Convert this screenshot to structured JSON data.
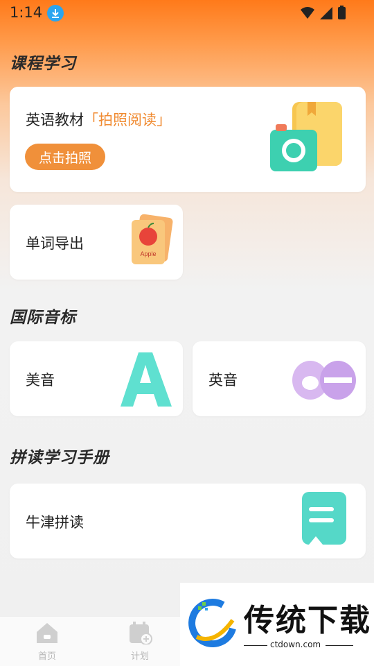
{
  "status_bar": {
    "time": "1:14"
  },
  "sections": {
    "course": {
      "title": "课程学习"
    },
    "phonetics": {
      "title": "国际音标"
    },
    "phonics": {
      "title": "拼读学习手册"
    }
  },
  "cards": {
    "textbook": {
      "label": "英语教材",
      "highlight": "「拍照阅读」",
      "button": "点击拍照"
    },
    "word_export": {
      "label": "单词导出",
      "picture_text": "Apple"
    },
    "us_accent": {
      "label": "美音"
    },
    "uk_accent": {
      "label": "英音"
    },
    "oxford": {
      "label": "牛津拼读"
    }
  },
  "bottom_nav": [
    {
      "label": "首页",
      "icon": "home-icon"
    },
    {
      "label": "计划",
      "icon": "calendar-plus-icon"
    }
  ],
  "watermark": {
    "name": "传统下载",
    "url": "ctdown.com"
  },
  "colors": {
    "accent": "#f0903a",
    "header": "#ff7a1a"
  }
}
